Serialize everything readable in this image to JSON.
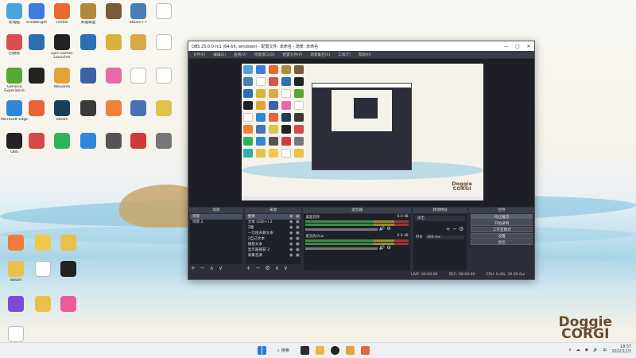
{
  "desktop": {
    "icons": [
      {
        "label": "此电脑",
        "color": "#4aa3df"
      },
      {
        "label": "Snowbright",
        "color": "#3b7ddd"
      },
      {
        "label": "Firefox",
        "color": "#e66b2e"
      },
      {
        "label": "英雄联盟",
        "color": "#b08a3a"
      },
      {
        "label": "",
        "color": "#7a5b3a"
      },
      {
        "label": "Steam++",
        "color": "#4a7fb5"
      },
      {
        "label": "",
        "color": "#ffffff"
      },
      {
        "label": "回收站",
        "color": "#d95050"
      },
      {
        "label": "",
        "color": "#2d6fb0"
      },
      {
        "label": "Epic Games Launcher",
        "color": "#222222"
      },
      {
        "label": "",
        "color": "#2d6fb5"
      },
      {
        "label": "",
        "color": "#d8b23a"
      },
      {
        "label": "",
        "color": "#d9a94a"
      },
      {
        "label": "",
        "color": "#ffffff"
      },
      {
        "label": "GeForce Experience",
        "color": "#56a832"
      },
      {
        "label": "",
        "color": "#222222"
      },
      {
        "label": "WeGame",
        "color": "#e2a23a"
      },
      {
        "label": "",
        "color": "#3f5fa8"
      },
      {
        "label": "",
        "color": "#e76aa8"
      },
      {
        "label": "",
        "color": "#ffffff"
      },
      {
        "label": "",
        "color": "#ffffff"
      },
      {
        "label": "Microsoft Edge",
        "color": "#2f86d8"
      },
      {
        "label": "",
        "color": "#e8633a"
      },
      {
        "label": "Steam",
        "color": "#1b3c5a"
      },
      {
        "label": "",
        "color": "#3a3a3a"
      },
      {
        "label": "",
        "color": "#ef7f3a"
      },
      {
        "label": "",
        "color": "#4a6fb5"
      },
      {
        "label": "",
        "color": "#e0c34a"
      },
      {
        "label": "OBS",
        "color": "#222222"
      },
      {
        "label": "",
        "color": "#d24a4a"
      },
      {
        "label": "",
        "color": "#2fb35a"
      },
      {
        "label": "",
        "color": "#2f88d8"
      },
      {
        "label": "",
        "color": "#555555"
      },
      {
        "label": "",
        "color": "#d23a3a"
      },
      {
        "label": "",
        "color": "#777777"
      },
      {
        "label": "",
        "color": "#2fb3a0"
      },
      {
        "label": "Steam",
        "color": "#e8c04a"
      },
      {
        "label": "",
        "color": "#efc94a"
      },
      {
        "label": "",
        "color": "#ffffff"
      },
      {
        "label": "",
        "color": "#e8c04a"
      },
      {
        "label": "",
        "color": "#222222"
      },
      {
        "label": "",
        "color": "#7a4bd6"
      },
      {
        "label": "",
        "color": "#ffffff"
      },
      {
        "label": "",
        "color": "#e8c04a"
      },
      {
        "label": "",
        "color": "#ef5a9a"
      },
      {
        "label": "",
        "color": "#ef7a3a"
      }
    ],
    "brand": [
      "Doggie",
      "CORGI"
    ]
  },
  "obs": {
    "title": "OBS 25.0.0-rc1 (64-bit, windows) - 配置文件: 未命名 - 场景: 未命名",
    "win_controls": [
      "—",
      "▢",
      "✕"
    ],
    "menu": [
      "文件(F)",
      "编辑(E)",
      "查看(V)",
      "停靠窗口(D)",
      "配置文件(P)",
      "场景集合(S)",
      "工具(T)",
      "帮助(H)"
    ],
    "docks": {
      "scenes": {
        "title": "场景",
        "items": [
          "场景",
          "场景 2"
        ],
        "selected": 0
      },
      "sources": {
        "title": "来源",
        "items": [
          "图像",
          "文本 (GDI+) 2",
          "2图",
          "一元组去数文本",
          "2自己文本",
          "播放文本",
          "显示器捕获 2",
          "采集音源"
        ],
        "selected": 0
      },
      "mixer": {
        "title": "混音器",
        "tracks": [
          {
            "name": "桌面音频",
            "db": "0.0 dB"
          },
          {
            "name": "麦克风/Aux",
            "db": "0.0 dB"
          }
        ]
      },
      "transitions": {
        "title": "转场特效",
        "current": "淡出",
        "duration_label": "时长",
        "duration": "300 ms"
      },
      "controls": {
        "title": "控件",
        "buttons": [
          "停止推流",
          "开始录制",
          "工作室模式",
          "设置",
          "退出"
        ],
        "active": 0
      }
    },
    "footer_icons": [
      "+",
      "−",
      "⚙",
      "∧",
      "∨"
    ],
    "status": {
      "live": "LIVE: 00:00:00",
      "rec": "REC: 00:00:00",
      "cpu": "CPU: 0.4%, 30.00 fps"
    }
  },
  "taskbar": {
    "search_label": "搜索",
    "tray": [
      "∧",
      "☁",
      "◉",
      "🔊",
      "中"
    ],
    "time": "18:57",
    "date": "2022/12/3"
  }
}
